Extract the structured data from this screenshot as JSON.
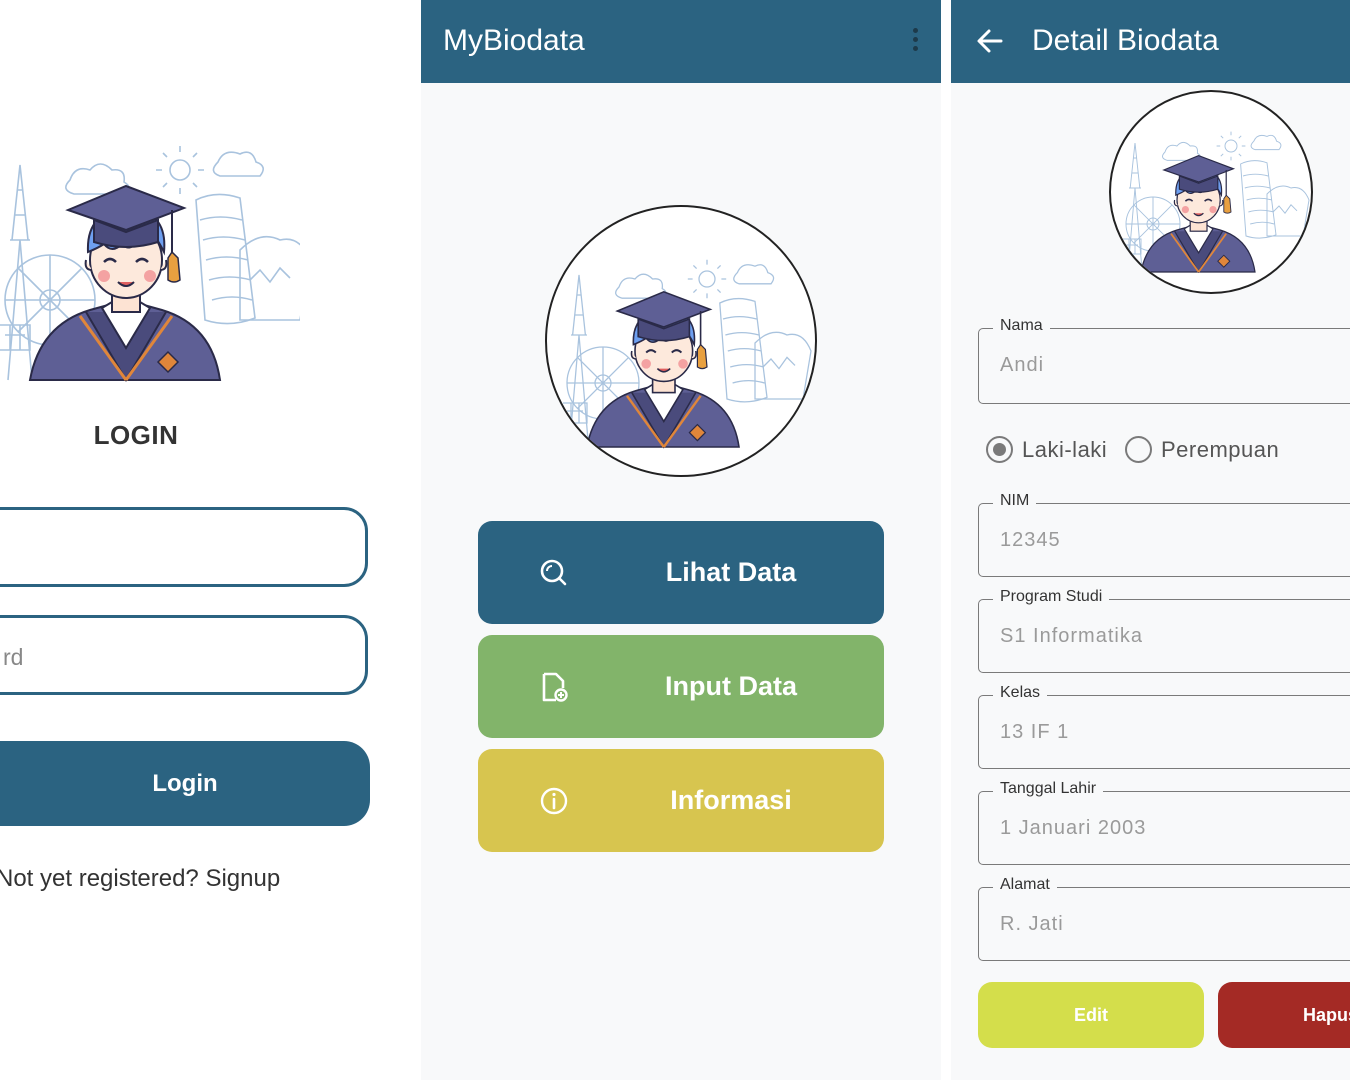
{
  "login": {
    "title": "LOGIN",
    "password_placeholder": "rd",
    "login_button": "Login",
    "signup_text": "Not yet registered? Signup"
  },
  "home": {
    "app_title": "MyBiodata",
    "menu": [
      {
        "label": "Lihat Data",
        "icon": "search-icon",
        "color": "#2b6381"
      },
      {
        "label": "Input Data",
        "icon": "document-add-icon",
        "color": "#82b46a"
      },
      {
        "label": "Informasi",
        "icon": "info-icon",
        "color": "#d7c54f"
      }
    ]
  },
  "detail": {
    "title": "Detail Biodata",
    "fields": {
      "nama": {
        "label": "Nama",
        "value": "Andi"
      },
      "nim": {
        "label": "NIM",
        "value": "12345"
      },
      "prodi": {
        "label": "Program Studi",
        "value": "S1 Informatika"
      },
      "kelas": {
        "label": "Kelas",
        "value": "13 IF 1"
      },
      "tanggal": {
        "label": "Tanggal Lahir",
        "value": "1 Januari 2003"
      },
      "alamat": {
        "label": "Alamat",
        "value": "R. Jati"
      }
    },
    "gender": {
      "options": [
        "Laki-laki",
        "Perempuan"
      ],
      "selected": "Laki-laki"
    },
    "edit_button": "Edit",
    "delete_button": "Hapus"
  },
  "colors": {
    "primary": "#2b6381",
    "green": "#82b46a",
    "yellow": "#d7c54f",
    "lime": "#d4de4b",
    "red": "#a42a25"
  }
}
